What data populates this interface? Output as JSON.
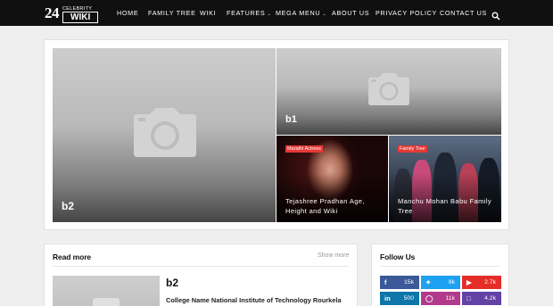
{
  "logo": {
    "number": "24",
    "top": "CELEBRITY",
    "bottom": "WIKI"
  },
  "nav": {
    "items": [
      {
        "label": "HOME"
      },
      {
        "label": "FAMILY TREE"
      },
      {
        "label": "WIKI"
      },
      {
        "label": "FEATURES",
        "dropdown": true
      },
      {
        "label": "MEGA MENU",
        "dropdown": true
      },
      {
        "label": "ABOUT US"
      },
      {
        "label": "PRIVACY POLICY"
      },
      {
        "label": "CONTACT US"
      }
    ],
    "search_icon": "search-icon"
  },
  "hero": {
    "main": {
      "title": "b2",
      "icon": "camera-icon"
    },
    "top_right": {
      "title": "b1",
      "icon": "camera-icon"
    },
    "bottom_left": {
      "category": "Marathi Actress",
      "title": "Tejashree Pradhan Age, Height and Wiki"
    },
    "bottom_right": {
      "category": "Family Tree",
      "title": "Manchu Mohan Babu Family Tree"
    },
    "badge_color": "#e53935"
  },
  "read_more": {
    "heading": "Read more",
    "show_more": "Show more",
    "post": {
      "title": "b2",
      "meta": "College Name National Institute of Technology Rourkela"
    }
  },
  "follow_us": {
    "heading": "Follow Us",
    "networks": [
      {
        "icon": "f",
        "name": "facebook-icon",
        "count": "15k",
        "color": "#3b5998"
      },
      {
        "icon": "t",
        "name": "twitter-icon",
        "count": "8k",
        "color": "#1da1f2"
      },
      {
        "icon": "y",
        "name": "youtube-icon",
        "count": "2.7k",
        "color": "#e52d27"
      },
      {
        "icon": "in",
        "name": "linkedin-icon",
        "count": "500",
        "color": "#0e76a8"
      },
      {
        "icon": "ig",
        "name": "instagram-icon",
        "count": "11k",
        "color": "#b13a8c"
      },
      {
        "icon": "tw",
        "name": "twitch-icon",
        "count": "4.2k",
        "color": "#6441a5"
      }
    ]
  }
}
